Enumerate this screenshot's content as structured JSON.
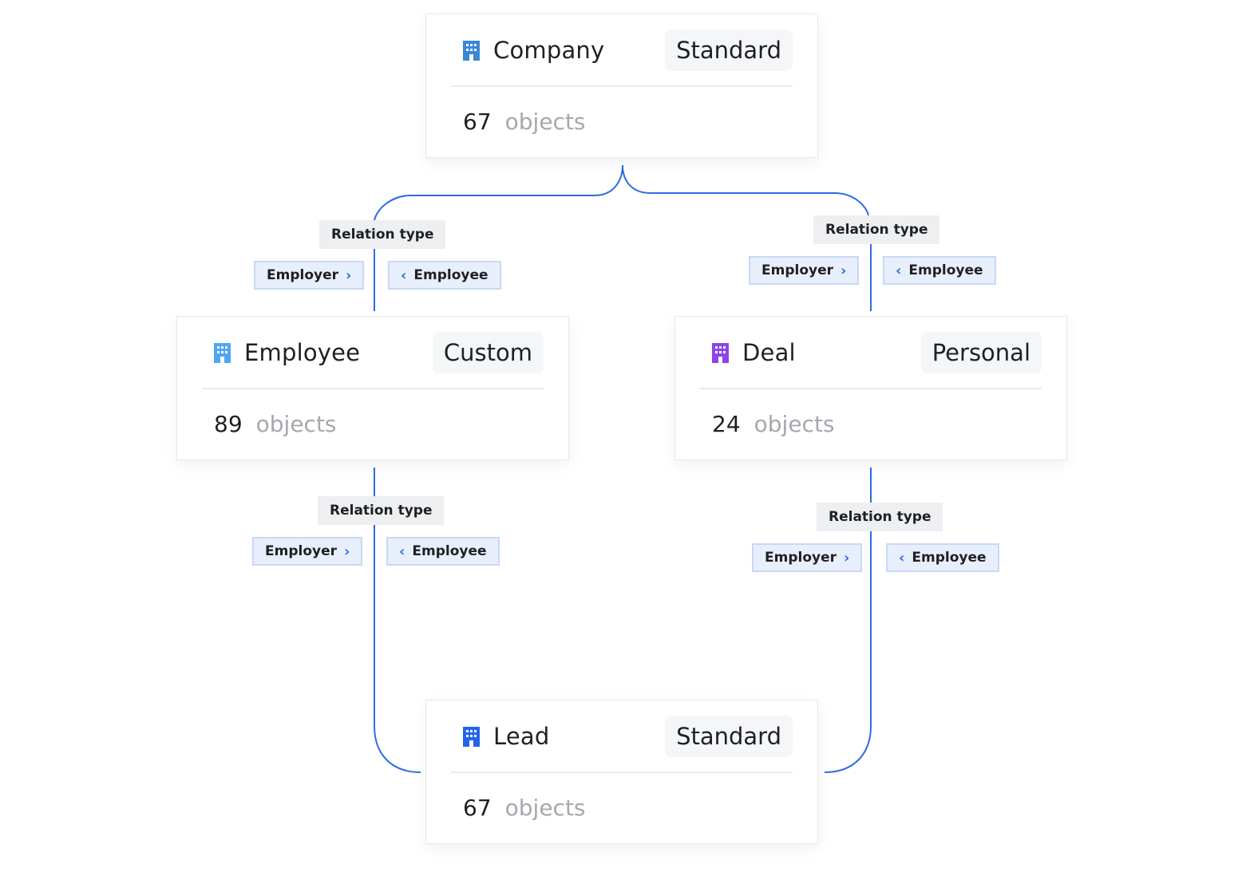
{
  "colors": {
    "connector": "#2f6be3",
    "company_icon": "#3a87d6",
    "employee_icon": "#4fa6f2",
    "deal_icon": "#8d44ea",
    "lead_icon": "#2563eb"
  },
  "objects": {
    "company": {
      "icon": "building-icon",
      "title": "Company",
      "badge": "Standard",
      "count": "67",
      "unit": "objects"
    },
    "employee": {
      "icon": "building-icon",
      "title": "Employee",
      "badge": "Custom",
      "count": "89",
      "unit": "objects"
    },
    "deal": {
      "icon": "building-icon",
      "title": "Deal",
      "badge": "Personal",
      "count": "24",
      "unit": "objects"
    },
    "lead": {
      "icon": "building-icon",
      "title": "Lead",
      "badge": "Standard",
      "count": "67",
      "unit": "objects"
    }
  },
  "relations": {
    "company_employee": {
      "label": "Relation type",
      "forward": "Employer",
      "backward": "Employee"
    },
    "company_deal": {
      "label": "Relation type",
      "forward": "Employer",
      "backward": "Employee"
    },
    "employee_lead": {
      "label": "Relation type",
      "forward": "Employer",
      "backward": "Employee"
    },
    "deal_lead": {
      "label": "Relation type",
      "forward": "Employer",
      "backward": "Employee"
    }
  },
  "glyphs": {
    "chevron_right": "›",
    "chevron_left": "‹"
  }
}
